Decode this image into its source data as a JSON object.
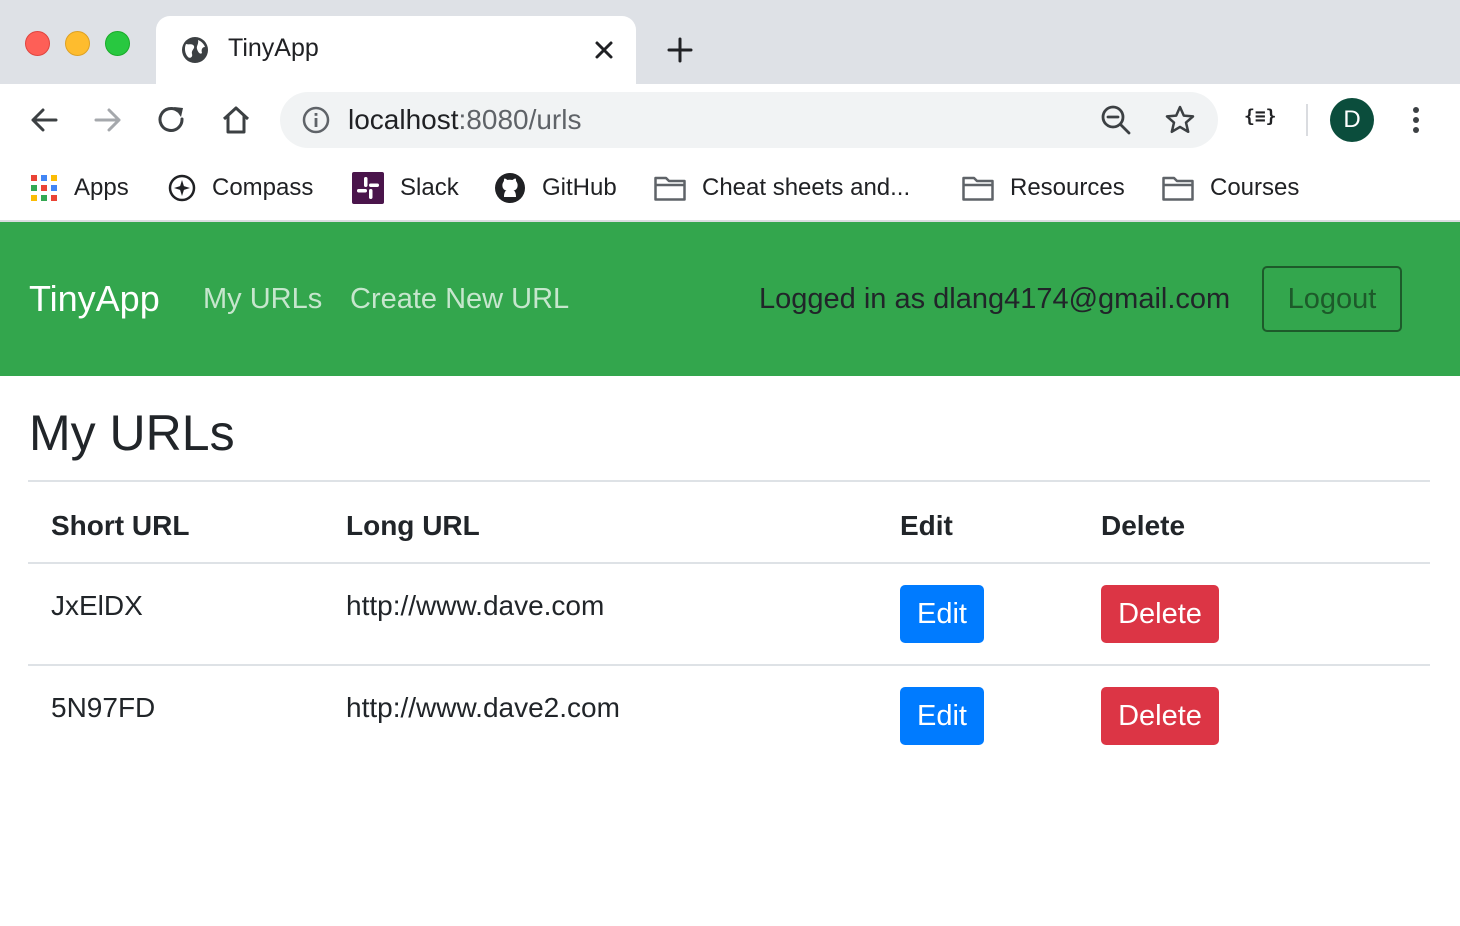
{
  "browser": {
    "tab_title": "TinyApp",
    "url_host": "localhost",
    "url_rest": ":8080/urls",
    "extension_label": "{≡}",
    "profile_initial": "D",
    "bookmarks": [
      {
        "label": "Apps",
        "icon": "apps-grid-icon"
      },
      {
        "label": "Compass",
        "icon": "compass-icon"
      },
      {
        "label": "Slack",
        "icon": "slack-icon"
      },
      {
        "label": "GitHub",
        "icon": "github-icon"
      },
      {
        "label": "Cheat sheets and...",
        "icon": "folder-icon"
      },
      {
        "label": "Resources",
        "icon": "folder-icon"
      },
      {
        "label": "Courses",
        "icon": "folder-icon"
      }
    ]
  },
  "navbar": {
    "brand": "TinyApp",
    "links": [
      "My URLs",
      "Create New URL"
    ],
    "logged_in_text": "Logged in as dlang4174@gmail.com",
    "logout_label": "Logout",
    "color": "#33a64d"
  },
  "main": {
    "title": "My URLs",
    "table": {
      "headers": [
        "Short URL",
        "Long URL",
        "Edit",
        "Delete"
      ],
      "rows": [
        {
          "short": "JxElDX",
          "long": "http://www.dave.com",
          "edit": "Edit",
          "delete": "Delete"
        },
        {
          "short": "5N97FD",
          "long": "http://www.dave2.com",
          "edit": "Edit",
          "delete": "Delete"
        }
      ]
    }
  },
  "colors": {
    "edit_button": "#007bff",
    "delete_button": "#dc3545"
  }
}
